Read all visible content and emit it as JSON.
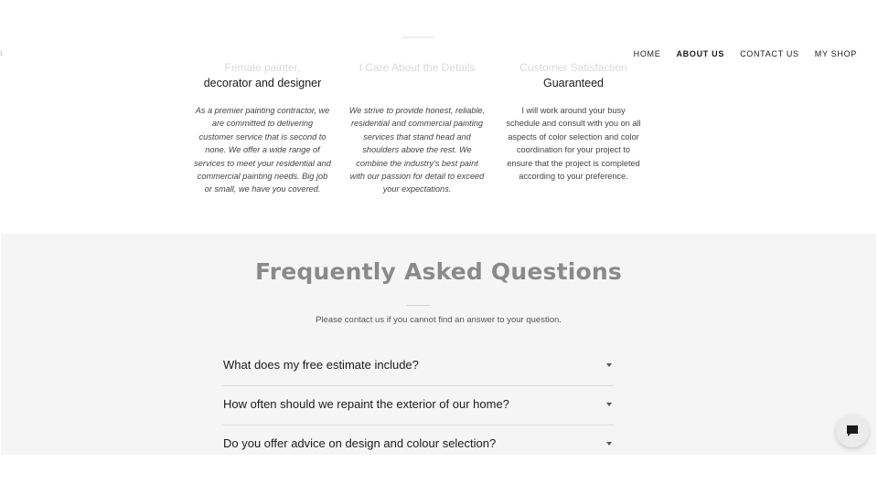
{
  "nav": {
    "items": [
      {
        "label": "HOME"
      },
      {
        "label": "ABOUT US",
        "active": true
      },
      {
        "label": "CONTACT US"
      },
      {
        "label": "MY SHOP"
      }
    ]
  },
  "features": [
    {
      "title_faded": "Female painter,",
      "title": "decorator and designer",
      "description": "As a premier painting contractor, we are committed to delivering customer service that is second to none. We offer a wide range of services to meet your residential and commercial painting needs. Big job or small, we have you covered."
    },
    {
      "title_faded": "I Care About the Details",
      "title": "",
      "description": "We strive to provide honest, reliable, residential and commercial painting services that stand head and shoulders above the rest. We combine the industry's best paint with our passion for detail to exceed your expectations."
    },
    {
      "title_faded": "Customer Satisfaction",
      "title": "Guaranteed",
      "description": "I will work around your busy schedule and consult with you on all aspects of color selection and color coordination for your project to ensure that the project is completed according to your preference."
    }
  ],
  "faq": {
    "title": "Frequently Asked Questions",
    "subtitle": "Please contact us if you cannot find an answer to your question.",
    "items": [
      {
        "question": "What does my free estimate include?"
      },
      {
        "question": "How often should we repaint the exterior of our home?"
      },
      {
        "question": "Do you offer advice on design and colour selection?"
      }
    ]
  },
  "icons": {
    "chat": "chat-bubble-icon",
    "expand": "chevron-down-icon"
  },
  "colors": {
    "faq_background": "#f5f5f5",
    "faq_title": "#8a8a8a",
    "text": "#1b1b1b"
  }
}
